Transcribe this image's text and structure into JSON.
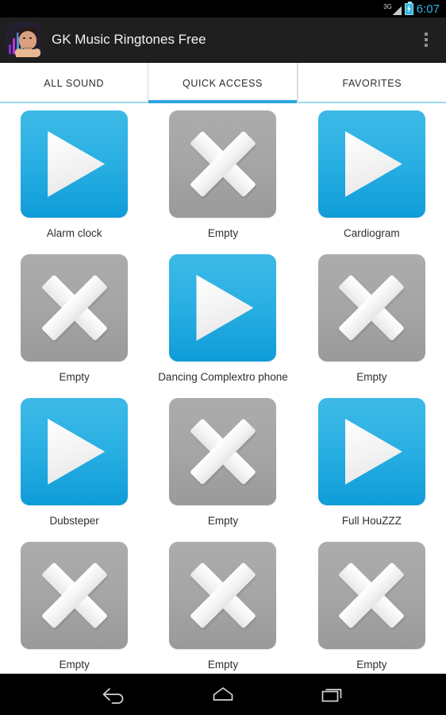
{
  "status_bar": {
    "network_label": "3G",
    "signal_icon": "signal-triangle-icon",
    "battery_icon": "battery-charging-icon",
    "time": "6:07",
    "time_color": "#33b5e5"
  },
  "action_bar": {
    "app_icon": "app-logo-icon",
    "title": "GK Music Ringtones Free",
    "overflow_icon": "overflow-menu-icon",
    "background": "#1f1f1f"
  },
  "tabs": {
    "active_index": 1,
    "accent_color": "#2aa5dd",
    "items": [
      {
        "label": "ALL SOUND"
      },
      {
        "label": "QUICK ACCESS"
      },
      {
        "label": "FAVORITES"
      }
    ]
  },
  "grid": {
    "play_tile_color": "#2cb1e4",
    "empty_tile_color": "#a6a6a6",
    "cells": [
      {
        "label": "Alarm clock",
        "state": "play",
        "icon": "play-icon"
      },
      {
        "label": "Empty",
        "state": "empty",
        "icon": "cross-icon"
      },
      {
        "label": "Cardiogram",
        "state": "play",
        "icon": "play-icon"
      },
      {
        "label": "Empty",
        "state": "empty",
        "icon": "cross-icon"
      },
      {
        "label": "Dancing Complextro phone",
        "state": "play",
        "icon": "play-icon"
      },
      {
        "label": "Empty",
        "state": "empty",
        "icon": "cross-icon"
      },
      {
        "label": "Dubsteper",
        "state": "play",
        "icon": "play-icon"
      },
      {
        "label": "Empty",
        "state": "empty",
        "icon": "cross-icon"
      },
      {
        "label": "Full HouZZZ",
        "state": "play",
        "icon": "play-icon"
      },
      {
        "label": "Empty",
        "state": "empty",
        "icon": "cross-icon"
      },
      {
        "label": "Empty",
        "state": "empty",
        "icon": "cross-icon"
      },
      {
        "label": "Empty",
        "state": "empty",
        "icon": "cross-icon"
      }
    ]
  },
  "nav_bar": {
    "back": "back-icon",
    "home": "home-icon",
    "recents": "recents-icon"
  }
}
